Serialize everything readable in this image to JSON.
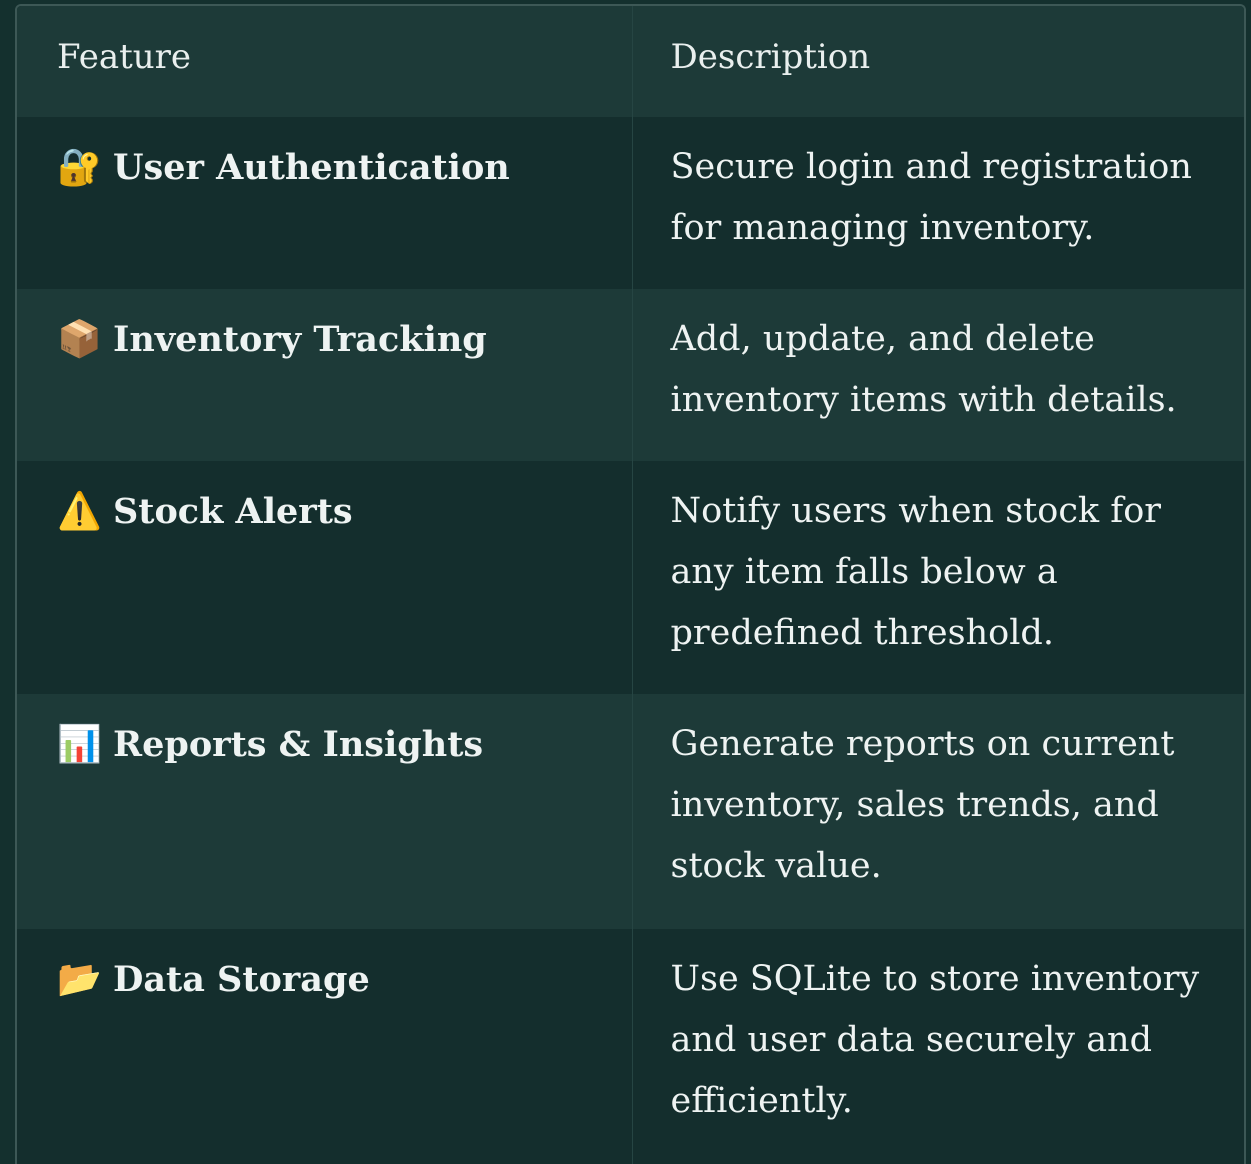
{
  "table": {
    "headers": {
      "feature": "Feature",
      "description": "Description"
    },
    "rows": [
      {
        "icon": "🔐",
        "icon_name": "locked-with-key-icon",
        "feature": "User Authentication",
        "description": "Secure login and registration for managing inventory."
      },
      {
        "icon": "📦",
        "icon_name": "package-icon",
        "feature": "Inventory Tracking",
        "description": "Add, update, and delete inventory items with details."
      },
      {
        "icon": "⚠️",
        "icon_name": "warning-icon",
        "feature": "Stock Alerts",
        "description": "Notify users when stock for any item falls below a predefined threshold."
      },
      {
        "icon": "📊",
        "icon_name": "bar-chart-icon",
        "feature": "Reports & Insights",
        "description": "Generate reports on current inventory, sales trends, and stock value."
      },
      {
        "icon": "📂",
        "icon_name": "open-folder-icon",
        "feature": "Data Storage",
        "description": "Use SQLite to store inventory and user data securely and efficiently."
      }
    ]
  },
  "colors": {
    "background": "#14302e",
    "row_dark": "#142e2d",
    "row_light": "#1d3a38",
    "text": "#eef3f2",
    "border": "#3d5856"
  }
}
